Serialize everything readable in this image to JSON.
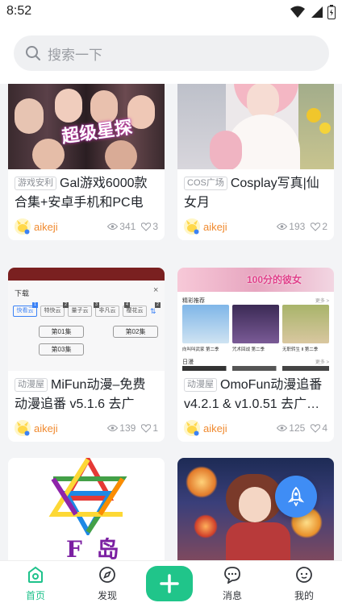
{
  "status": {
    "time": "8:52"
  },
  "search": {
    "placeholder": "搜索一下"
  },
  "cards": [
    {
      "tag": "游戏安利",
      "title": "Gal游戏6000款合集+安卓手机和PC电脑…",
      "cover_text": "超级星探",
      "author": "aikeji",
      "views": "341",
      "likes": "3"
    },
    {
      "tag": "COS广场",
      "title": "Cosplay写真|仙女月",
      "author": "aikeji",
      "views": "193",
      "likes": "2"
    },
    {
      "tag": "动漫屋",
      "title": "MiFun动漫–免费动漫追番 v5.1.6 去广告…",
      "author": "aikeji",
      "views": "139",
      "likes": "1",
      "cover": {
        "header": "下载",
        "close": "×",
        "chips": [
          "快看云",
          "特快云",
          "量子云",
          "非凡云",
          "樱花云"
        ],
        "chip_badges": [
          "1",
          "2",
          "3",
          "4",
          "2"
        ],
        "sort": "⇅",
        "episodes": [
          "第01集",
          "第02集",
          "第03集"
        ]
      }
    },
    {
      "tag": "动漫屋",
      "title": "OmoFun动漫追番 v4.2.1 & v1.0.51 去广…",
      "author": "aikeji",
      "views": "125",
      "likes": "4",
      "cover": {
        "banner": "100分的彼女",
        "section1": "精彩推荐",
        "more1": "更多 >",
        "items": [
          "向叫叫武家 第二季",
          "咒术回战 第二季",
          "无职转生 Ⅱ 第二季"
        ],
        "section2": "日漫",
        "more2": "更多 >"
      }
    },
    {
      "cover_text": "F 岛"
    },
    {}
  ],
  "tabs": [
    {
      "label": "首页",
      "icon": "home-icon",
      "active": true
    },
    {
      "label": "发现",
      "icon": "compass-icon",
      "active": false
    },
    {
      "label": "消息",
      "icon": "message-icon",
      "active": false
    },
    {
      "label": "我的",
      "icon": "profile-icon",
      "active": false
    }
  ],
  "colors": {
    "accent": "#1ec28b",
    "author": "#f08a2f",
    "fab": "#3f8df5"
  }
}
